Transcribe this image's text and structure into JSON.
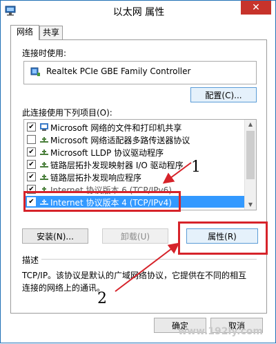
{
  "window": {
    "title": "以太网 属性",
    "close_label": "✕"
  },
  "tabs": [
    {
      "label": "网络",
      "active": true
    },
    {
      "label": "共享",
      "active": false
    }
  ],
  "connect_using": {
    "label": "连接时使用:",
    "adapter": "Realtek PCIe GBE Family Controller",
    "config_button": "配置(C)..."
  },
  "items_section": {
    "label": "此连接使用下列项目(O):",
    "items": [
      {
        "label": "Microsoft 网络的文件和打印机共享",
        "checked": true
      },
      {
        "label": "Microsoft 网络适配器多路传送器协议",
        "checked": false
      },
      {
        "label": "Microsoft LLDP 协议驱动程序",
        "checked": true
      },
      {
        "label": "链路层拓扑发现映射器 I/O 驱动程序",
        "checked": true
      },
      {
        "label": "链路层拓扑发现响应程序",
        "checked": true
      },
      {
        "label": "Internet 协议版本 6 (TCP/IPv6)",
        "checked": true
      },
      {
        "label": "Internet 协议版本 4 (TCP/IPv4)",
        "checked": true,
        "selected": true
      }
    ]
  },
  "buttons": {
    "install": "安装(N)...",
    "uninstall": "卸载(U)",
    "properties": "属性(R)",
    "ok": "确定",
    "cancel": "取消"
  },
  "description": {
    "label": "描述",
    "text": "TCP/IP。该协议是默认的广域网络协议，它提供在不同的相互连接的网络上的通讯。"
  },
  "annotations": {
    "num1": "1",
    "num2": "2",
    "color": "#d6232a"
  },
  "watermark": "www.192ly.com"
}
